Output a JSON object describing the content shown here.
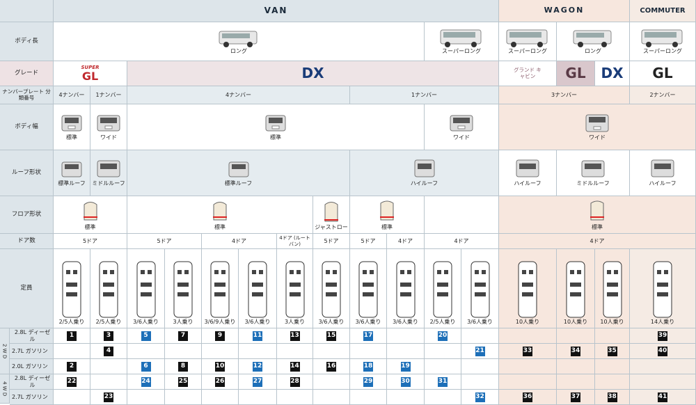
{
  "headers": {
    "van": "VAN",
    "wagon": "WAGON",
    "commuter": "COMMUTER"
  },
  "rows": {
    "body_length": "ボディ長",
    "grade": "グレード",
    "plate": "ナンバープレート 分類番号",
    "body_width": "ボディ幅",
    "roof": "ルーフ形状",
    "floor": "フロア形状",
    "doors": "ドア数",
    "capacity": "定員"
  },
  "body_length": {
    "long": "ロング",
    "super_long1": "スーパーロング",
    "super_long2": "スーパーロング",
    "long2": "ロング",
    "super_long3": "スーパーロング"
  },
  "grade": {
    "super": "SUPER",
    "gl": "GL",
    "dx": "DX",
    "grand": "グランド キャビン",
    "gl2": "GL",
    "dx2": "DX",
    "gl3": "GL"
  },
  "plate": {
    "p1": "4ナンバー",
    "p2": "1ナンバー",
    "p3": "4ナンバー",
    "p4": "1ナンバー",
    "p5": "3ナンバー",
    "p6": "2ナンバー"
  },
  "width": {
    "w1": "標準",
    "w2": "ワイド",
    "w3": "標準",
    "w4": "ワイド",
    "w5": "ワイド"
  },
  "roof": {
    "r1": "標準ルーフ",
    "r2": "ミドルルーフ",
    "r3": "標準ルーフ",
    "r4": "ハイルーフ",
    "r5": "ハイルーフ",
    "r6": "ミドルルーフ",
    "r7": "ハイルーフ"
  },
  "floor": {
    "f1": "標準",
    "f2": "標準",
    "f3": "ジャストロー",
    "f4": "標準",
    "f5": "標準"
  },
  "doors": {
    "d1": "5ドア",
    "d2": "5ドア",
    "d3": "4ドア",
    "d4": "4ドア (ルートバン)",
    "d5": "5ドア",
    "d6": "5ドア",
    "d7": "4ドア",
    "d8": "4ドア",
    "d9": "4ドア"
  },
  "capacity": [
    "2/5人乗り",
    "2/5人乗り",
    "3/6人乗り",
    "3人乗り",
    "3/6/9人乗り",
    "3/6人乗り",
    "3人乗り",
    "3/6人乗り",
    "3/6人乗り",
    "3/6人乗り",
    "2/5人乗り",
    "3/6人乗り",
    "10人乗り",
    "10人乗り",
    "10人乗り",
    "14人乗り"
  ],
  "drive": {
    "wd2": "2 W D",
    "wd4": "4 W D"
  },
  "engines": [
    "2.8L ディーゼル",
    "2.7L ガソリン",
    "2.0L ガソリン",
    "2.8L ディーゼル",
    "2.7L ガソリン"
  ],
  "nums": {
    "n1": "1",
    "n3": "3",
    "n5": "5",
    "n7": "7",
    "n9": "9",
    "n11": "11",
    "n13": "13",
    "n15": "15",
    "n17": "17",
    "n20": "20",
    "n39": "39",
    "n4": "4",
    "n21": "21",
    "n33": "33",
    "n34": "34",
    "n35": "35",
    "n40": "40",
    "n2": "2",
    "n6": "6",
    "n8": "8",
    "n10": "10",
    "n12": "12",
    "n14": "14",
    "n16": "16",
    "n18": "18",
    "n19": "19",
    "n22": "22",
    "n24": "24",
    "n25": "25",
    "n26": "26",
    "n27": "27",
    "n28": "28",
    "n29": "29",
    "n30": "30",
    "n31": "31",
    "n23": "23",
    "n32": "32",
    "n36": "36",
    "n37": "37",
    "n38": "38",
    "n41": "41"
  },
  "colors": {
    "black_badge": "#111111",
    "blue_badge": "#1d6fb8",
    "van_bg": "#e5ecf0",
    "wagon_bg": "#f7e7de"
  }
}
